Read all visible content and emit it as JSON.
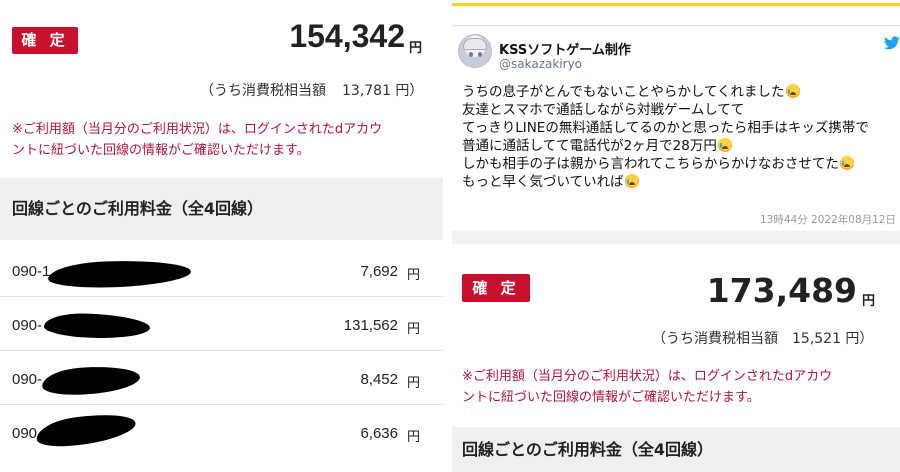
{
  "left_bill": {
    "badge": "確 定",
    "total_amount": "154,342",
    "yen": "円",
    "tax_label": "（うち消費税相当額",
    "tax_value": "13,781 円）",
    "notice_line1": "※ご利用額（当月分のご利用状況）は、ログインされたdアカウ",
    "notice_line2": "ントに紐づいた回線の情報がご確認いただけます。",
    "section_title": "回線ごとのご利用料金（全4回線）",
    "lines": [
      {
        "number": "090-1",
        "fee": "7,692",
        "yen": "円"
      },
      {
        "number": "090-",
        "fee": "131,562",
        "yen": "円"
      },
      {
        "number": "090-",
        "fee": "8,452",
        "yen": "円"
      },
      {
        "number": "090",
        "fee": "6,636",
        "yen": "円"
      }
    ]
  },
  "tweet": {
    "name": "KSSソフトゲーム制作",
    "handle": "@sakazakiryo",
    "lines": [
      "うちの息子がとんでもないことやらかしてくれました",
      "友達とスマホで通話しながら対戦ゲームしてて",
      "てっきりLINEの無料通話してるのかと思ったら相手はキッズ携帯で",
      "普通に通話してて電話代が2ヶ月で28万円",
      "しかも相手の子は親から言われてこちらからかけなおさせてた",
      "もっと早く気づいていれば"
    ],
    "timestamp": "13時44分  2022年08月12日",
    "bird_color": "#1da1f2",
    "emoji": "crying-face"
  },
  "right_bill": {
    "badge": "確 定",
    "total_amount": "173,489",
    "yen": "円",
    "tax_label": "（うち消費税相当額",
    "tax_value": "15,521 円）",
    "notice_line1": "※ご利用額（当月分のご利用状況）は、ログインされたdアカウ",
    "notice_line2": "ントに紐づいた回線の情報がご確認いただけます。",
    "section_title": "回線ごとのご利用料金（全4回線）"
  },
  "colors": {
    "accent_red": "#c8102e",
    "notice_red": "#b0153c",
    "section_bg": "#efefef"
  }
}
